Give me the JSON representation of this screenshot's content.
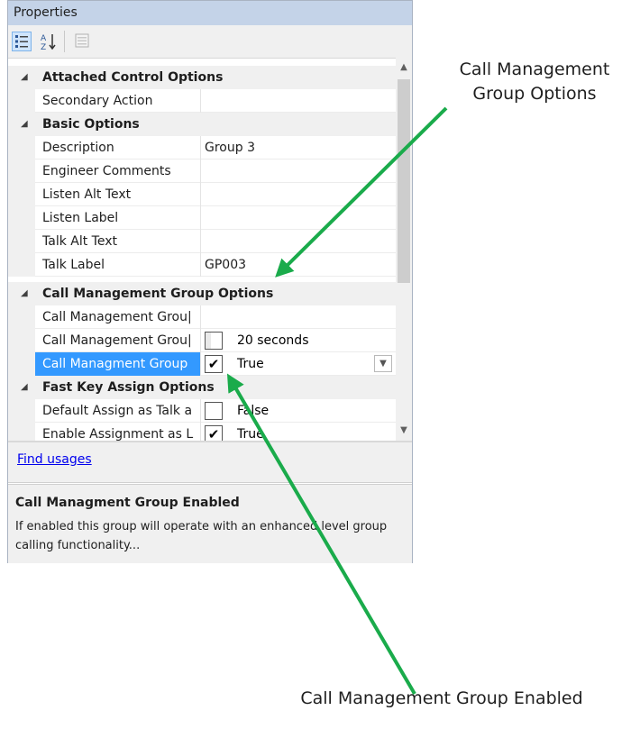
{
  "panel": {
    "title": "Properties",
    "toolbar": {
      "categorized_icon": "categorized-icon",
      "alphabetical_label": "A Z",
      "property_pages_icon": "property-pages-icon"
    }
  },
  "grid": {
    "categories": {
      "attached": "Attached Control Options",
      "basic": "Basic Options",
      "callmgmt": "Call Management Group Options",
      "fastkey": "Fast Key Assign Options"
    },
    "rows": {
      "secondary_action": {
        "name": "Secondary Action",
        "value": ""
      },
      "description": {
        "name": "Description",
        "value": "Group 3"
      },
      "engineer_comments": {
        "name": "Engineer Comments",
        "value": ""
      },
      "listen_alt_text": {
        "name": "Listen Alt Text",
        "value": ""
      },
      "listen_label": {
        "name": "Listen Label",
        "value": ""
      },
      "talk_alt_text": {
        "name": "Talk Alt Text",
        "value": ""
      },
      "talk_label": {
        "name": "Talk Label",
        "value": "GP003"
      },
      "cm_group_1": {
        "name": "Call Management Grou|",
        "value": ""
      },
      "cm_group_2": {
        "name": "Call Management Grou|",
        "value": "20 seconds",
        "checked": false
      },
      "cm_group_enabled": {
        "name": "Call Managment Group",
        "value": "True",
        "checked": true
      },
      "default_assign": {
        "name": "Default Assign as Talk a",
        "value": "False",
        "checked": false
      },
      "enable_assignment": {
        "name": "Enable Assignment as L",
        "value": "True",
        "checked": true
      }
    }
  },
  "commands": {
    "find_usages": "Find usages"
  },
  "description": {
    "title": "Call Managment Group Enabled",
    "text": "If enabled this group will operate with an enhanced level group calling functionality..."
  },
  "annotations": {
    "top_line1": "Call Management",
    "top_line2": "Group Options",
    "bottom": "Call Management Group Enabled",
    "arrow_color": "#1aab4b"
  },
  "colors": {
    "titlebar": "#c4d3e8",
    "selection": "#3399ff",
    "link": "#0000ee"
  }
}
